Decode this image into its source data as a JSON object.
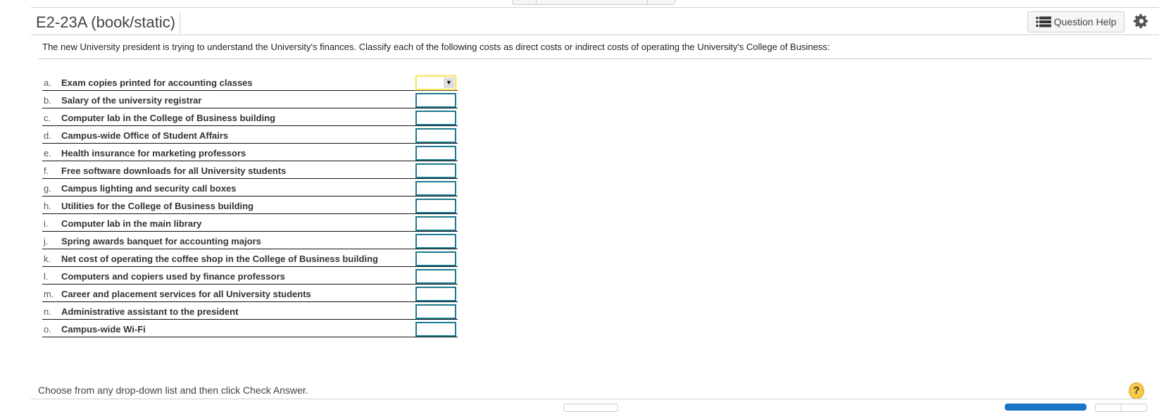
{
  "header": {
    "title": "E2-23A (book/static)",
    "question_help_label": "Question Help",
    "question_help_icon": "list-icon",
    "settings_icon": "gear-icon"
  },
  "prompt": "The new University president is trying to understand the University's finances. Classify each of the following costs as direct costs or indirect costs of operating the University's College of Business:",
  "items": [
    {
      "letter": "a.",
      "text": "Exam copies printed for accounting classes",
      "value": ""
    },
    {
      "letter": "b.",
      "text": "Salary of the university registrar",
      "value": ""
    },
    {
      "letter": "c.",
      "text": "Computer lab in the College of Business building",
      "value": ""
    },
    {
      "letter": "d.",
      "text": "Campus-wide Office of Student Affairs",
      "value": ""
    },
    {
      "letter": "e.",
      "text": "Health insurance for marketing professors",
      "value": ""
    },
    {
      "letter": "f.",
      "text": "Free software downloads for all University students",
      "value": ""
    },
    {
      "letter": "g.",
      "text": "Campus lighting and security call boxes",
      "value": ""
    },
    {
      "letter": "h.",
      "text": "Utilities for the College of Business building",
      "value": ""
    },
    {
      "letter": "i.",
      "text": "Computer lab in the main library",
      "value": ""
    },
    {
      "letter": "j.",
      "text": "Spring awards banquet for accounting majors",
      "value": ""
    },
    {
      "letter": "k.",
      "text": "Net cost of operating the coffee shop in the College of Business building",
      "value": ""
    },
    {
      "letter": "l.",
      "text": "Computers and copiers used by finance professors",
      "value": ""
    },
    {
      "letter": "m.",
      "text": "Career and placement services for all University students",
      "value": ""
    },
    {
      "letter": "n.",
      "text": "Administrative assistant to the president",
      "value": ""
    },
    {
      "letter": "o.",
      "text": "Campus-wide Wi-Fi",
      "value": ""
    }
  ],
  "dropdown_arrow": "▼",
  "footer": {
    "status_text": "Choose from any drop-down list and then click Check Answer.",
    "help_icon_glyph": "?"
  },
  "colors": {
    "dropdown_border": "#1a7a91",
    "active_dropdown_border": "#f5e46a",
    "primary_button": "#1a73c4",
    "help_icon": "#f7c948"
  }
}
